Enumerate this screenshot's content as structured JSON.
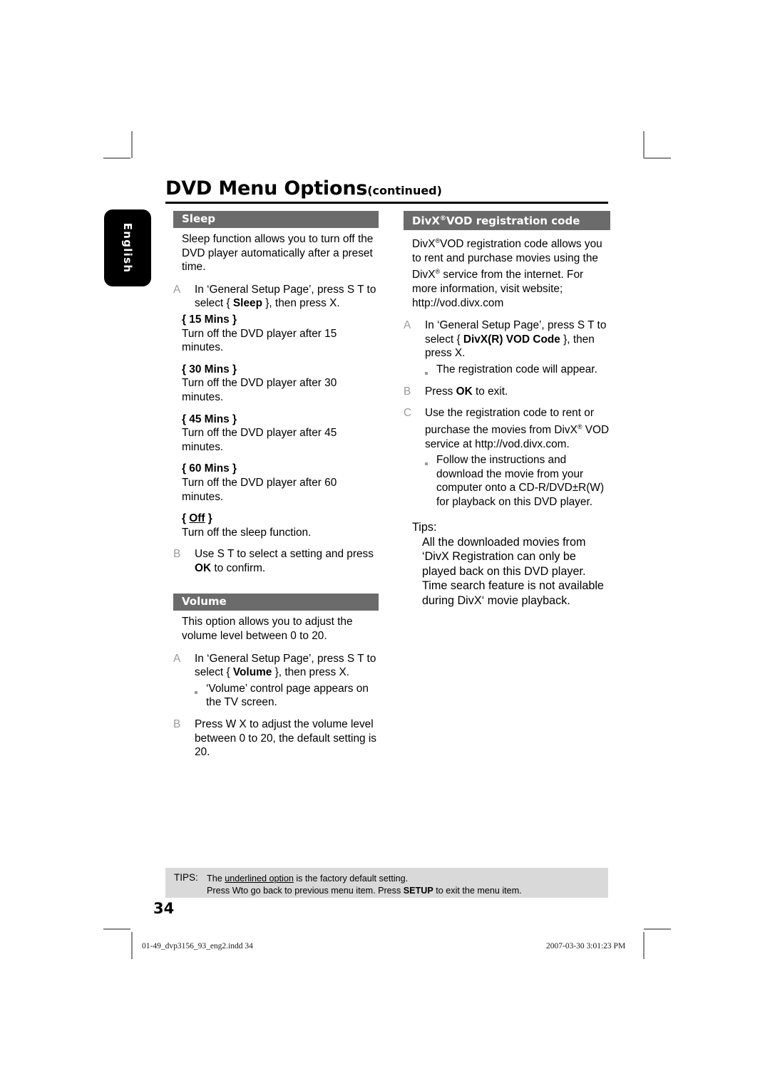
{
  "header": {
    "title": "DVD Menu Options",
    "continued": "(continued)"
  },
  "lang_tab": {
    "label": "English"
  },
  "left_column": {
    "sleep": {
      "heading": "Sleep",
      "intro": "Sleep function allows you to turn off the DVD player automatically after a preset time.",
      "step_a": {
        "letter": "A",
        "text_1": "In ‘General Setup Page’, press  S  T  to select { ",
        "bold": "Sleep",
        "text_2": " }, then press  X."
      },
      "options": [
        {
          "name": "{ 15 Mins }",
          "desc": "Turn off the DVD player after 15 minutes."
        },
        {
          "name": "{ 30 Mins }",
          "desc": "Turn off the DVD player after 30 minutes."
        },
        {
          "name": "{ 45 Mins }",
          "desc": "Turn off the DVD player after 45 minutes."
        },
        {
          "name": "{ 60 Mins }",
          "desc": "Turn off the DVD player after 60 minutes."
        }
      ],
      "option_off": {
        "open": "{ ",
        "name": "Off",
        "close": " }",
        "desc": "Turn off the sleep function."
      },
      "step_b": {
        "letter": "B",
        "text_1": "Use  S  T  to select a setting and press ",
        "bold": "OK",
        "text_2": " to confirm."
      }
    },
    "volume": {
      "heading": "Volume",
      "intro": "This option allows you to adjust the volume level between 0 to 20.",
      "step_a": {
        "letter": "A",
        "text_1": "In ‘General Setup Page’, press  S  T  to select { ",
        "bold": "Volume",
        "text_2": " }, then press  X."
      },
      "sub_a": "‘Volume’ control page appears on the TV screen.",
      "step_b": {
        "letter": "B",
        "text": "Press  W X to adjust the volume level between 0 to 20, the default setting is 20."
      }
    }
  },
  "right_column": {
    "divx": {
      "heading_1": "DivX",
      "heading_sup": "®",
      "heading_2": "VOD registration code",
      "intro_1": "DivX",
      "intro_sup_1": "®",
      "intro_2": "VOD registration code allows you to rent and purchase movies using the DivX",
      "intro_sup_2": "®",
      "intro_3": " service from the internet. For more information, visit website; http://vod.divx.com",
      "step_a": {
        "letter": "A",
        "text_1": "In ‘General Setup Page’, press  S  T  to select { ",
        "bold": "DivX(R) VOD Code",
        "text_2": " }, then press  X."
      },
      "sub_a": "The registration code will appear.",
      "step_b": {
        "letter": "B",
        "text_1": "Press ",
        "bold": "OK",
        "text_2": " to exit."
      },
      "step_c": {
        "letter": "C",
        "text_1": "Use the registration code to rent or purchase the movies from DivX",
        "sup": "®",
        "text_2": " VOD service at http://vod.divx.com."
      },
      "sub_c": "Follow the instructions and download the movie from your computer onto a CD-R/DVD±R(W) for playback on this DVD player.",
      "tips_label": "Tips:",
      "tips_1": "All the downloaded movies from ‘DivX Registration can only be played back on this DVD player.",
      "tips_2": "Time search feature is not available during DivX‘ movie playback."
    }
  },
  "tips_bar": {
    "label": "TIPS:",
    "line_1_pre": "The ",
    "line_1_underline": "underlined option",
    "line_1_post": " is the factory default setting.",
    "line_2_pre": "Press  Wto go back to previous menu item. Press ",
    "line_2_bold": "SETUP",
    "line_2_post": " to exit the menu item."
  },
  "page_number": "34",
  "print_footer": {
    "file": "01-49_dvp3156_93_eng2.indd   34",
    "timestamp": "2007-03-30   3:01:23 PM"
  },
  "colors": {
    "section_heading_bg": "#6b6b6b",
    "tips_bar_bg": "#d9d9d9",
    "step_letter": "#9a9a9a",
    "lang_tab_bg": "#000000"
  }
}
